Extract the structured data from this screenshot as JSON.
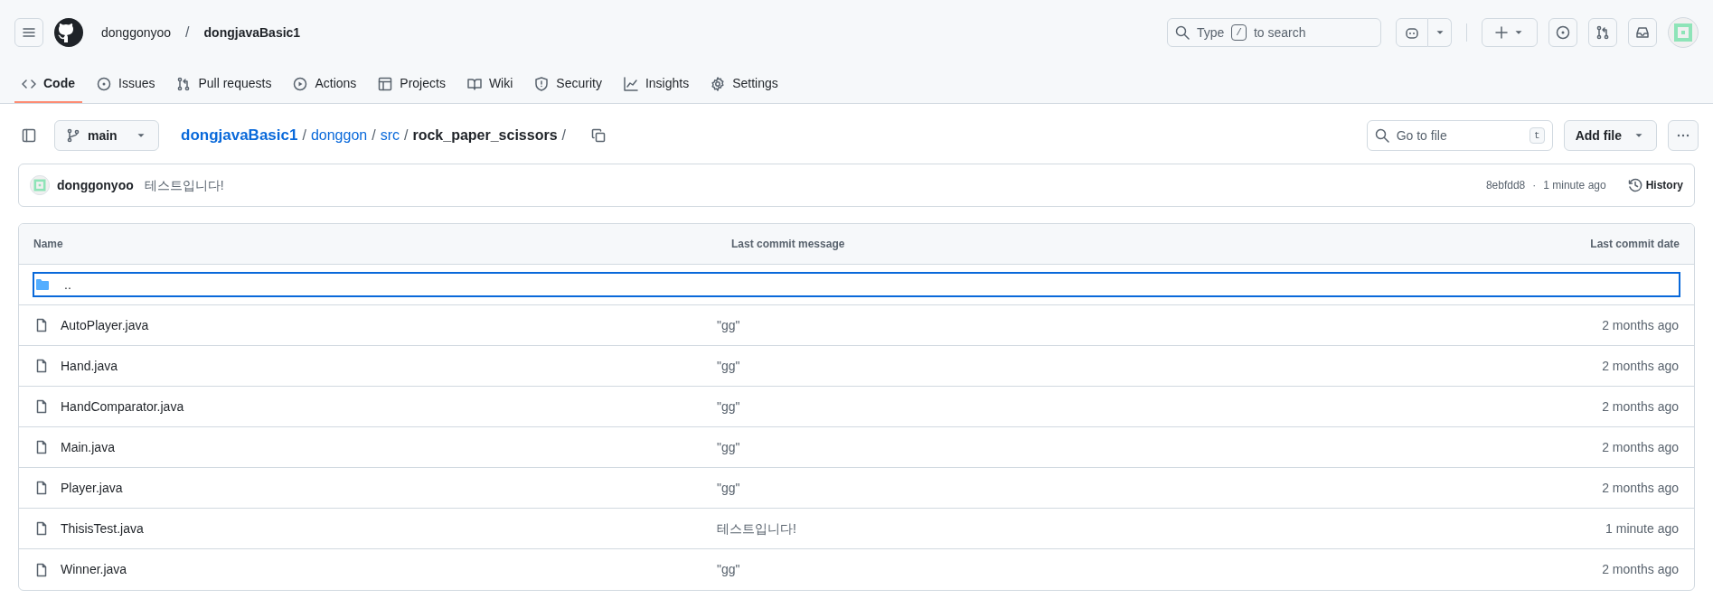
{
  "header": {
    "owner": "donggonyoo",
    "separator": "/",
    "repo": "dongjavaBasic1",
    "search": {
      "before": "Type",
      "key": "/",
      "after": "to search"
    }
  },
  "tabs": [
    {
      "label": "Code",
      "kind": "code",
      "selected": true
    },
    {
      "label": "Issues",
      "kind": "issue",
      "selected": false
    },
    {
      "label": "Pull requests",
      "kind": "pr",
      "selected": false
    },
    {
      "label": "Actions",
      "kind": "play",
      "selected": false
    },
    {
      "label": "Projects",
      "kind": "table",
      "selected": false
    },
    {
      "label": "Wiki",
      "kind": "book",
      "selected": false
    },
    {
      "label": "Security",
      "kind": "shield",
      "selected": false
    },
    {
      "label": "Insights",
      "kind": "graph",
      "selected": false
    },
    {
      "label": "Settings",
      "kind": "gear",
      "selected": false
    }
  ],
  "branch": "main",
  "breadcrumb": [
    {
      "label": "dongjavaBasic1",
      "kind": "root"
    },
    {
      "label": "donggon",
      "kind": "link"
    },
    {
      "label": "src",
      "kind": "link"
    },
    {
      "label": "rock_paper_scissors",
      "kind": "current"
    }
  ],
  "breadcrumb_separator": "/",
  "go_to_file": {
    "placeholder": "Go to file",
    "key": "t"
  },
  "add_file": "Add file",
  "commit": {
    "author": "donggonyoo",
    "message": "테스트입니다!",
    "sha": "8ebfdd8",
    "dot": "·",
    "time": "1 minute ago",
    "history": "History"
  },
  "table": {
    "columns": [
      "Name",
      "Last commit message",
      "Last commit date"
    ],
    "rows": [
      {
        "kind": "parent",
        "name": "..",
        "selected": true
      },
      {
        "kind": "file",
        "name": "AutoPlayer.java",
        "message": "\"gg\"",
        "date": "2 months ago",
        "selected": false
      },
      {
        "kind": "file",
        "name": "Hand.java",
        "message": "\"gg\"",
        "date": "2 months ago",
        "selected": false
      },
      {
        "kind": "file",
        "name": "HandComparator.java",
        "message": "\"gg\"",
        "date": "2 months ago",
        "selected": false
      },
      {
        "kind": "file",
        "name": "Main.java",
        "message": "\"gg\"",
        "date": "2 months ago",
        "selected": false
      },
      {
        "kind": "file",
        "name": "Player.java",
        "message": "\"gg\"",
        "date": "2 months ago",
        "selected": false
      },
      {
        "kind": "file",
        "name": "ThisisTest.java",
        "message": "테스트입니다!",
        "date": "1 minute ago",
        "selected": false
      },
      {
        "kind": "file",
        "name": "Winner.java",
        "message": "\"gg\"",
        "date": "2 months ago",
        "selected": false
      }
    ]
  }
}
